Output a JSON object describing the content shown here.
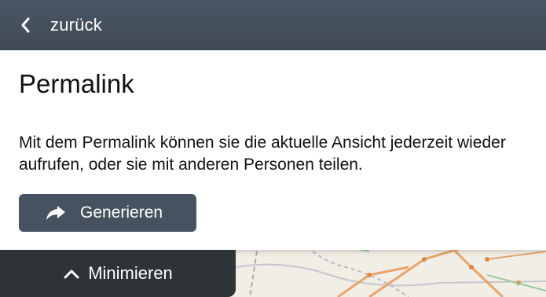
{
  "header": {
    "back_label": "zurück",
    "back_icon": "chevron-left-icon"
  },
  "panel": {
    "title": "Permalink",
    "description": "Mit dem Permalink können sie die aktuelle Ansicht jederzeit wieder aufrufen, oder sie mit anderen Personen teilen.",
    "generate_button": {
      "label": "Generieren",
      "icon": "share-arrow-icon"
    }
  },
  "minimize": {
    "label": "Minimieren",
    "icon": "chevron-up-icon"
  },
  "colors": {
    "header_bg": "#434e5a",
    "button_bg": "#46525f",
    "minimize_bg": "#2e3338",
    "panel_bg": "#ffffff",
    "map_bg": "#f1eee6",
    "map_route": "#e8a46a"
  }
}
